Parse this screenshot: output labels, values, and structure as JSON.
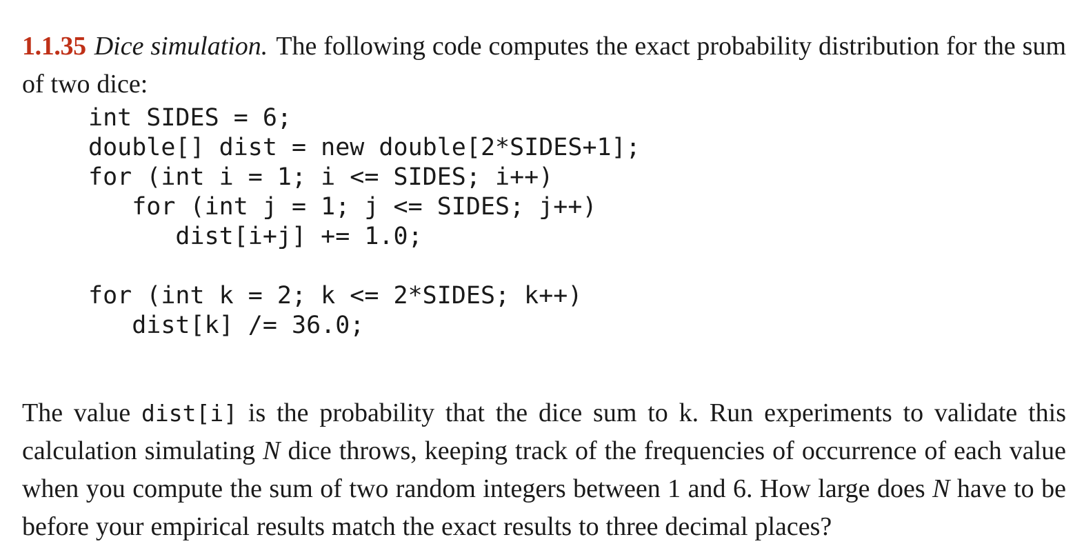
{
  "document": {
    "type": "textbook-exercise",
    "accent_color": "#bf3017",
    "text_color": "#1a1a1a",
    "background_color": "#ffffff"
  },
  "exercise": {
    "number": "1.1.35",
    "title": "Dice simulation.",
    "intro_text": "The following code computes the exact probability distribution for the sum of two dice:"
  },
  "code": {
    "language": "java",
    "lines": [
      "int SIDES = 6;",
      "double[] dist = new double[2*SIDES+1];",
      "for (int i = 1; i <= SIDES; i++)",
      "   for (int j = 1; j <= SIDES; j++)",
      "      dist[i+j] += 1.0;",
      "",
      "for (int k = 2; k <= 2*SIDES; k++)",
      "   dist[k] /= 36.0;"
    ]
  },
  "closing": {
    "part1": "The value ",
    "code_ref": "dist[i]",
    "part2": " is the probability that the dice sum to k. Run experiments to validate this calculation simulating ",
    "var1": "N",
    "part3": " dice throws, keeping track of the frequencies of occurrence of each value when you compute the sum of two random integers between 1 and 6. How large does ",
    "var2": "N",
    "part4": " have to be before your empirical results match the exact results to three decimal places?"
  }
}
